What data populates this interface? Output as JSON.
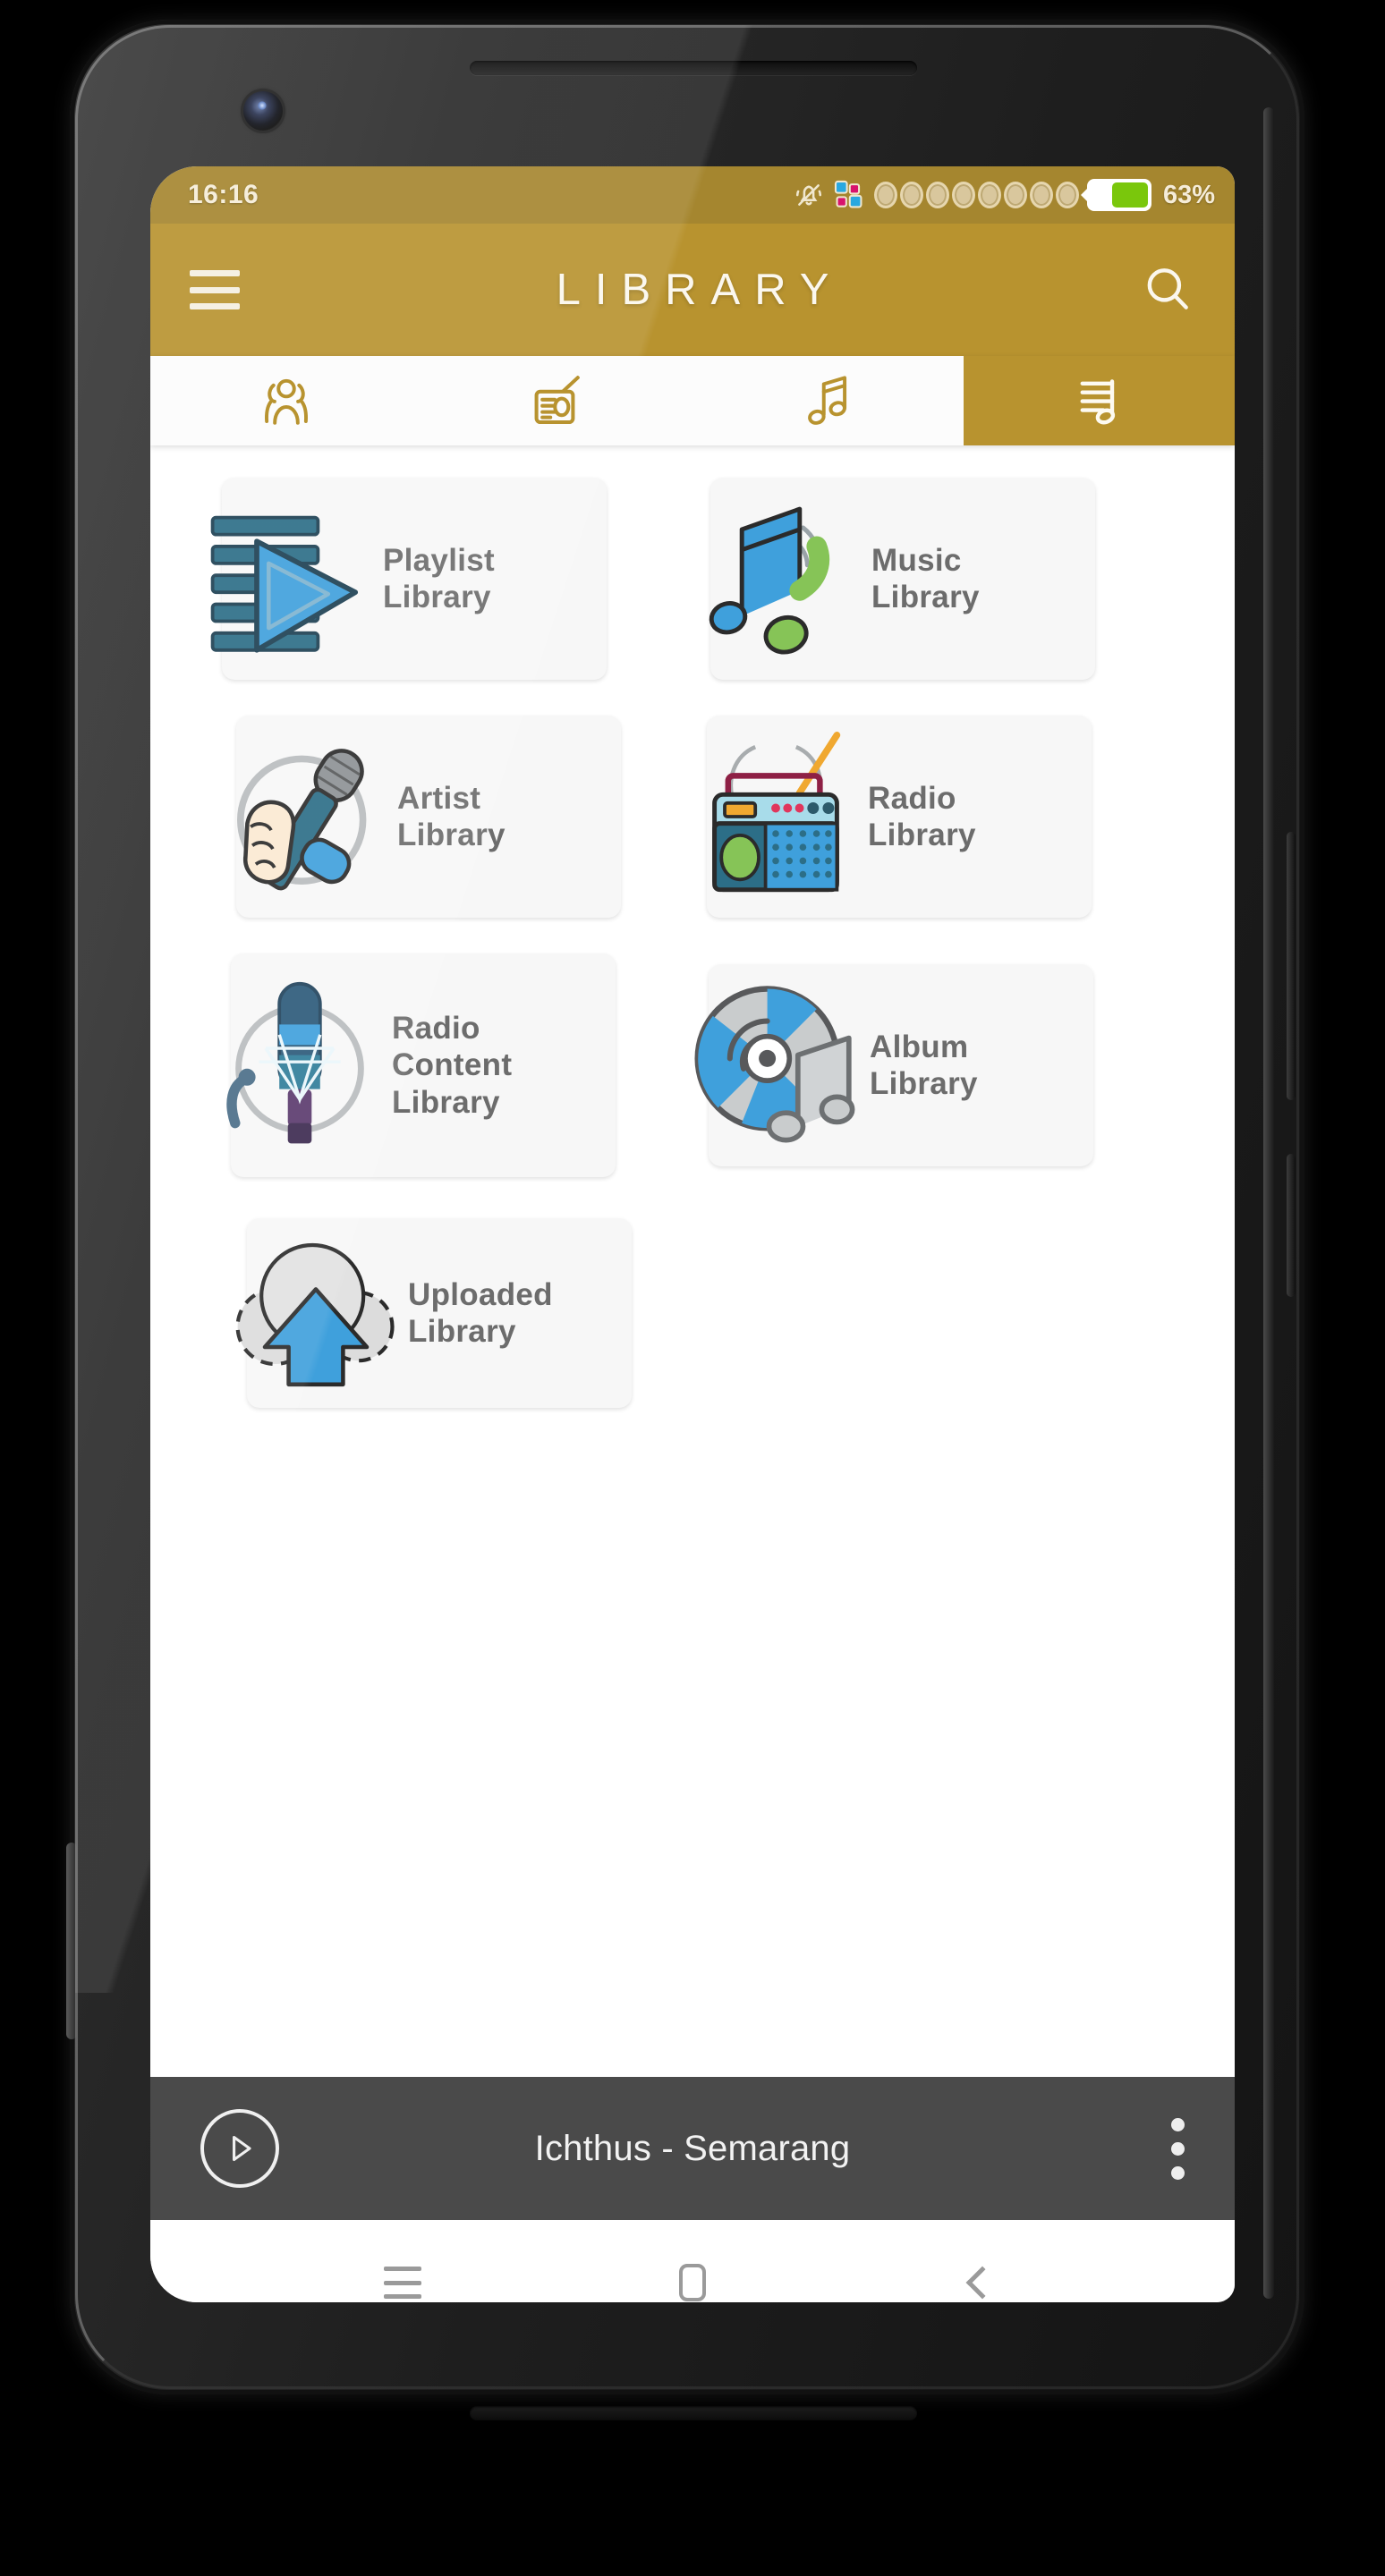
{
  "status_bar": {
    "time": "16:16",
    "battery_percent": "63%",
    "battery_level": 63,
    "icons": [
      "silent-mode-icon",
      "apps-grid-icon"
    ],
    "signal_dot_count": 8
  },
  "app_bar": {
    "menu_icon": "hamburger-menu-icon",
    "title": "LIBRARY",
    "search_icon": "search-icon"
  },
  "tabs": [
    {
      "name": "artists",
      "icon": "artists-people-icon",
      "active": false
    },
    {
      "name": "radio",
      "icon": "radio-receiver-icon",
      "active": false
    },
    {
      "name": "music",
      "icon": "music-note-icon",
      "active": false
    },
    {
      "name": "playlist",
      "icon": "playlist-note-icon",
      "active": true
    }
  ],
  "library_items": [
    {
      "label": "Playlist\nLibrary",
      "icon": "playlist-play-icon"
    },
    {
      "label": "Music\nLibrary",
      "icon": "music-note-wifi-icon"
    },
    {
      "label": "Artist\nLibrary",
      "icon": "hand-microphone-icon"
    },
    {
      "label": "Radio\nLibrary",
      "icon": "radio-set-icon"
    },
    {
      "label": "Radio\nContent\nLibrary",
      "icon": "studio-microphone-icon"
    },
    {
      "label": "Album\nLibrary",
      "icon": "cd-music-note-icon"
    },
    {
      "label": "Uploaded\nLibrary",
      "icon": "cloud-upload-icon"
    }
  ],
  "player": {
    "play_icon": "play-button-icon",
    "now_playing": "Ichthus - Semarang",
    "overflow_icon": "kebab-menu-icon"
  },
  "nav_bar": {
    "recents_icon": "recents-icon",
    "home_icon": "home-icon",
    "back_icon": "back-icon"
  },
  "colors": {
    "status_bar": "#a5862f",
    "app_bar": "#b8932f",
    "tab_active": "#b8932f",
    "player_bar": "#4a4a4a",
    "card_bg": "#f7f7f7",
    "label_text": "#6c6c6c",
    "accent_blue": "#3fa0dc",
    "accent_green": "#86c457",
    "accent_teal": "#2c6e87"
  }
}
